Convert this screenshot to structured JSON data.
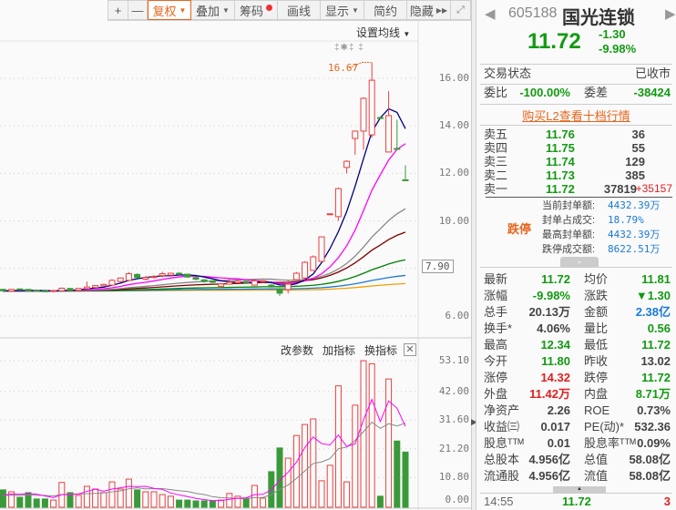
{
  "toolbar": {
    "zoom_in": "+",
    "zoom_out": "—",
    "fuquan": "复权",
    "overlay": "叠加",
    "chips": "筹码",
    "draw": "画线",
    "display": "显示",
    "simple": "简约",
    "hide": "隐藏"
  },
  "chart": {
    "ma_setting": "设置均线",
    "markers": "‡✱‡  ‡",
    "high_label": "16.67",
    "cursor_price": "7.90",
    "price_ticks": [
      16,
      14,
      12,
      10,
      6
    ],
    "price_tick_labels": [
      "16.00",
      "14.00",
      "12.00",
      "10.00",
      "6.00"
    ],
    "vol_ticks": [
      "53.10",
      "42.00",
      "31.60",
      "21.20",
      "10.80",
      "0.00"
    ],
    "vol_tick_values": [
      53.1,
      42,
      31.6,
      21.2,
      10.8,
      0
    ],
    "indicator_buttons": {
      "edit": "改参数",
      "add": "加指标",
      "switch": "换指标"
    },
    "colors": {
      "up": "#e84040",
      "down": "#3a9a3a",
      "ma5": "#000080",
      "ma10": "#ff00ff",
      "ma20": "#888888",
      "ma30": "#800000",
      "ma60": "#008000",
      "ma120": "#1a7ad4",
      "ma250": "#f0a000"
    },
    "candles": [
      [
        7.12,
        7.15,
        7.05,
        7.06
      ],
      [
        7.05,
        7.14,
        7.03,
        7.12
      ],
      [
        7.14,
        7.16,
        7.08,
        7.1
      ],
      [
        7.12,
        7.14,
        7.03,
        7.06
      ],
      [
        7.08,
        7.1,
        7.02,
        7.04
      ],
      [
        7.06,
        7.08,
        7.0,
        7.03
      ],
      [
        7.03,
        7.08,
        7.0,
        7.07
      ],
      [
        7.06,
        7.2,
        7.05,
        7.17
      ],
      [
        7.16,
        7.18,
        7.05,
        7.08
      ],
      [
        7.08,
        7.18,
        7.06,
        7.16
      ],
      [
        7.15,
        7.45,
        7.14,
        7.22
      ],
      [
        7.2,
        7.3,
        7.18,
        7.28
      ],
      [
        7.27,
        7.36,
        7.25,
        7.33
      ],
      [
        7.3,
        7.55,
        7.3,
        7.5
      ],
      [
        7.45,
        7.62,
        7.42,
        7.6
      ],
      [
        7.5,
        7.85,
        7.48,
        7.78
      ],
      [
        7.75,
        7.8,
        7.58,
        7.62
      ],
      [
        7.55,
        7.68,
        7.5,
        7.62
      ],
      [
        7.62,
        7.72,
        7.58,
        7.66
      ],
      [
        7.7,
        7.86,
        7.62,
        7.78
      ],
      [
        7.72,
        7.82,
        7.7,
        7.8
      ],
      [
        7.8,
        7.85,
        7.7,
        7.76
      ],
      [
        7.76,
        7.78,
        7.6,
        7.64
      ],
      [
        7.62,
        7.66,
        7.5,
        7.55
      ],
      [
        7.52,
        7.56,
        7.4,
        7.45
      ],
      [
        7.48,
        7.5,
        7.38,
        7.42
      ],
      [
        7.25,
        7.38,
        7.22,
        7.35
      ],
      [
        7.34,
        7.58,
        7.32,
        7.42
      ],
      [
        7.4,
        7.5,
        7.38,
        7.46
      ],
      [
        7.46,
        7.48,
        7.38,
        7.4
      ],
      [
        7.3,
        7.55,
        7.28,
        7.48
      ],
      [
        7.44,
        7.5,
        7.4,
        7.48
      ],
      [
        7.3,
        7.35,
        7.2,
        7.22
      ],
      [
        7.15,
        7.18,
        6.85,
        6.96
      ],
      [
        7.11,
        7.5,
        6.95,
        7.34
      ],
      [
        7.53,
        7.85,
        7.5,
        7.8
      ],
      [
        7.6,
        8.3,
        7.5,
        8.26
      ],
      [
        7.92,
        8.55,
        7.9,
        8.49
      ],
      [
        8.3,
        9.35,
        8.28,
        9.33
      ],
      [
        10.28,
        10.31,
        10.28,
        10.3
      ],
      [
        10.18,
        11.4,
        10.0,
        11.36
      ],
      [
        12.25,
        12.55,
        12.0,
        12.51
      ],
      [
        13.47,
        13.8,
        12.78,
        13.78
      ],
      [
        13.78,
        15.2,
        13.0,
        15.16
      ],
      [
        13.62,
        16.67,
        13.5,
        15.92
      ],
      [
        14.35,
        14.38,
        14.3,
        14.31
      ],
      [
        12.9,
        15.46,
        12.88,
        14.43
      ],
      [
        13.05,
        14.26,
        13.0,
        13.02
      ],
      [
        11.73,
        12.34,
        11.72,
        11.72
      ]
    ],
    "volumes": [
      6.3,
      5.6,
      3.6,
      5.3,
      3,
      3,
      2.6,
      9,
      5.3,
      4.3,
      7.6,
      6.6,
      5.3,
      9.2,
      6.6,
      10.2,
      6.3,
      5.6,
      5.6,
      4.6,
      4,
      2.6,
      2.6,
      2.3,
      2.3,
      2.3,
      2.6,
      5,
      4,
      3.3,
      7.9,
      3.3,
      12.9,
      21.5,
      17.8,
      26,
      30,
      32,
      9.6,
      15.2,
      44,
      9.2,
      37,
      53.1,
      52,
      4,
      46.5,
      24,
      20
    ]
  },
  "quote": {
    "code": "605188",
    "name": "国光连锁",
    "price": "11.72",
    "change": "-1.30",
    "change_pct": "-9.98%",
    "status_label": "交易状态",
    "status": "已收市",
    "wb_label": "委比",
    "wb": "-100.00%",
    "wc_label": "委差",
    "wc": "-38424",
    "l2_link": "购买L2查看十档行情",
    "asks": [
      {
        "label": "卖五",
        "price": "11.76",
        "vol": "36"
      },
      {
        "label": "卖四",
        "price": "11.75",
        "vol": "55"
      },
      {
        "label": "卖三",
        "price": "11.74",
        "vol": "129"
      },
      {
        "label": "卖二",
        "price": "11.73",
        "vol": "385"
      },
      {
        "label": "卖一",
        "price": "11.72",
        "vol": "37819",
        "delta": "+35157"
      }
    ],
    "limit_label": "跌停",
    "limit_rows": [
      {
        "label": "当前封单额:",
        "value": "4432.39万"
      },
      {
        "label": "封单占成交:",
        "value": "18.79%"
      },
      {
        "label": "最高封单额:",
        "value": "4432.39万"
      },
      {
        "label": "跌停成交额:",
        "value": "8622.51万"
      }
    ],
    "stats": [
      [
        "最新",
        "11.72",
        "g",
        "均价",
        "11.81",
        "g"
      ],
      [
        "涨幅",
        "-9.98%",
        "g",
        "涨跌",
        "▼1.30",
        "g"
      ],
      [
        "总手",
        "20.13万",
        "k",
        "金额",
        "2.38亿",
        "b"
      ],
      [
        "换手*",
        "4.06%",
        "k",
        "量比",
        "0.56",
        "g"
      ],
      [
        "最高",
        "12.34",
        "g",
        "最低",
        "11.72",
        "g"
      ],
      [
        "今开",
        "11.80",
        "g",
        "昨收",
        "13.02",
        "k"
      ],
      [
        "涨停",
        "14.32",
        "r",
        "跌停",
        "11.72",
        "g"
      ],
      [
        "外盘",
        "11.42万",
        "r",
        "内盘",
        "8.71万",
        "g"
      ],
      [
        "净资产",
        "2.26",
        "k",
        "ROE",
        "0.73%",
        "k"
      ],
      [
        "收益㈢",
        "0.017",
        "k",
        "PE(动)*",
        "532.36",
        "k"
      ],
      [
        "股息ᵀᵀᴹ",
        "0.01",
        "k",
        "股息率ᵀᵀᴹ",
        "0.09%",
        "k"
      ],
      [
        "总股本",
        "4.956亿",
        "k",
        "总值",
        "58.08亿",
        "k"
      ],
      [
        "流通股",
        "4.956亿",
        "k",
        "流值",
        "58.08亿",
        "k"
      ]
    ],
    "tick": {
      "time": "14:55",
      "price": "11.72",
      "vol": "3"
    }
  }
}
